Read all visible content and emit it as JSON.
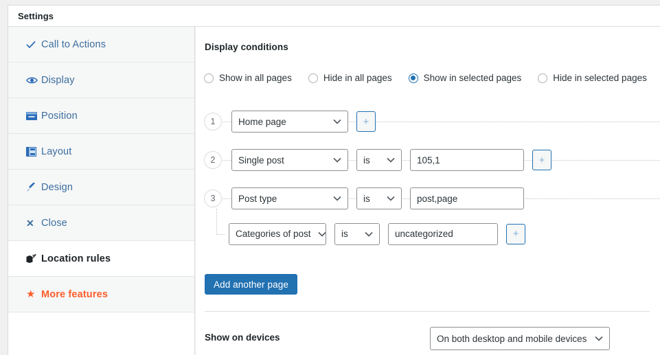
{
  "window": {
    "title": "Settings"
  },
  "sidebar": {
    "items": [
      {
        "label": "Call to Actions",
        "icon": "check-icon",
        "style": "link",
        "background": "gray"
      },
      {
        "label": "Display",
        "icon": "eye-icon",
        "style": "link",
        "background": "gray"
      },
      {
        "label": "Position",
        "icon": "position-icon",
        "style": "link",
        "background": "gray"
      },
      {
        "label": "Layout",
        "icon": "layout-icon",
        "style": "link",
        "background": "gray"
      },
      {
        "label": "Design",
        "icon": "brush-icon",
        "style": "link",
        "background": "gray"
      },
      {
        "label": "Close",
        "icon": "close-icon",
        "style": "link",
        "background": "gray"
      },
      {
        "label": "Location rules",
        "icon": "map-pin-icon",
        "style": "bold",
        "background": "white"
      },
      {
        "label": "More features",
        "icon": "star-icon",
        "style": "orange",
        "background": "gray"
      }
    ]
  },
  "main": {
    "section_title": "Display conditions",
    "radios": [
      {
        "label": "Show in all pages",
        "checked": false
      },
      {
        "label": "Hide in all pages",
        "checked": false
      },
      {
        "label": "Show in selected pages",
        "checked": true
      },
      {
        "label": "Hide in selected pages",
        "checked": false
      }
    ],
    "rules": [
      {
        "index": "1",
        "condition": "Home page",
        "operator": null,
        "value": null,
        "add_label": "+",
        "sub": null
      },
      {
        "index": "2",
        "condition": "Single post",
        "operator": "is",
        "value": "105,1",
        "add_label": "+",
        "sub": null
      },
      {
        "index": "3",
        "condition": "Post type",
        "operator": "is",
        "value": "post,page",
        "add_label": "+",
        "sub": {
          "condition": "Categories of post",
          "operator": "is",
          "value": "uncategorized",
          "add_label": "+"
        }
      }
    ],
    "add_another_label": "Add another page",
    "devices_label": "Show on devices",
    "devices_value": "On both desktop and mobile devices"
  },
  "colors": {
    "accent_blue": "#2271b1",
    "link_blue": "#3c6e9f",
    "orange": "#fc5e2b",
    "border_gray": "#8c8f94"
  }
}
